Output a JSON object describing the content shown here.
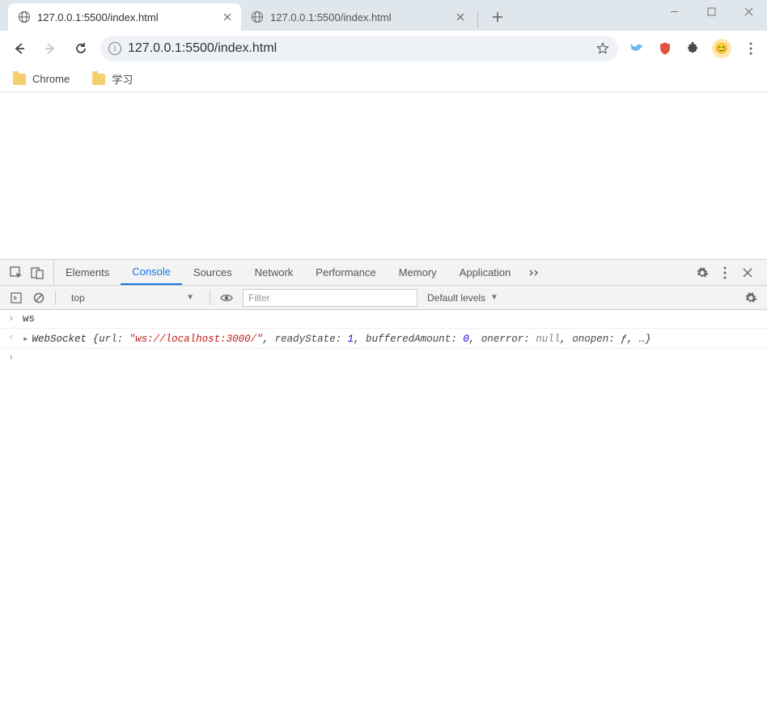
{
  "window": {
    "controls": {
      "minimize": "minimize",
      "maximize": "maximize",
      "close": "close"
    }
  },
  "tabs": [
    {
      "title": "127.0.0.1:5500/index.html",
      "active": true
    },
    {
      "title": "127.0.0.1:5500/index.html",
      "active": false
    }
  ],
  "address": {
    "url": "127.0.0.1:5500/index.html"
  },
  "bookmarks": [
    {
      "label": "Chrome"
    },
    {
      "label": "学习"
    }
  ],
  "devtools": {
    "panels": [
      "Elements",
      "Console",
      "Sources",
      "Network",
      "Performance",
      "Memory",
      "Application"
    ],
    "active_panel": "Console",
    "context_selector": "top",
    "filter_placeholder": "Filter",
    "levels_label": "Default levels",
    "console": {
      "rows": [
        {
          "type": "input",
          "text": "ws"
        },
        {
          "type": "output",
          "className": "WebSocket",
          "props": {
            "url": "\"ws://localhost:3000/\"",
            "readyState": "1",
            "bufferedAmount": "0",
            "onerror": "null",
            "onopen": "ƒ",
            "rest": "…"
          }
        }
      ]
    }
  }
}
